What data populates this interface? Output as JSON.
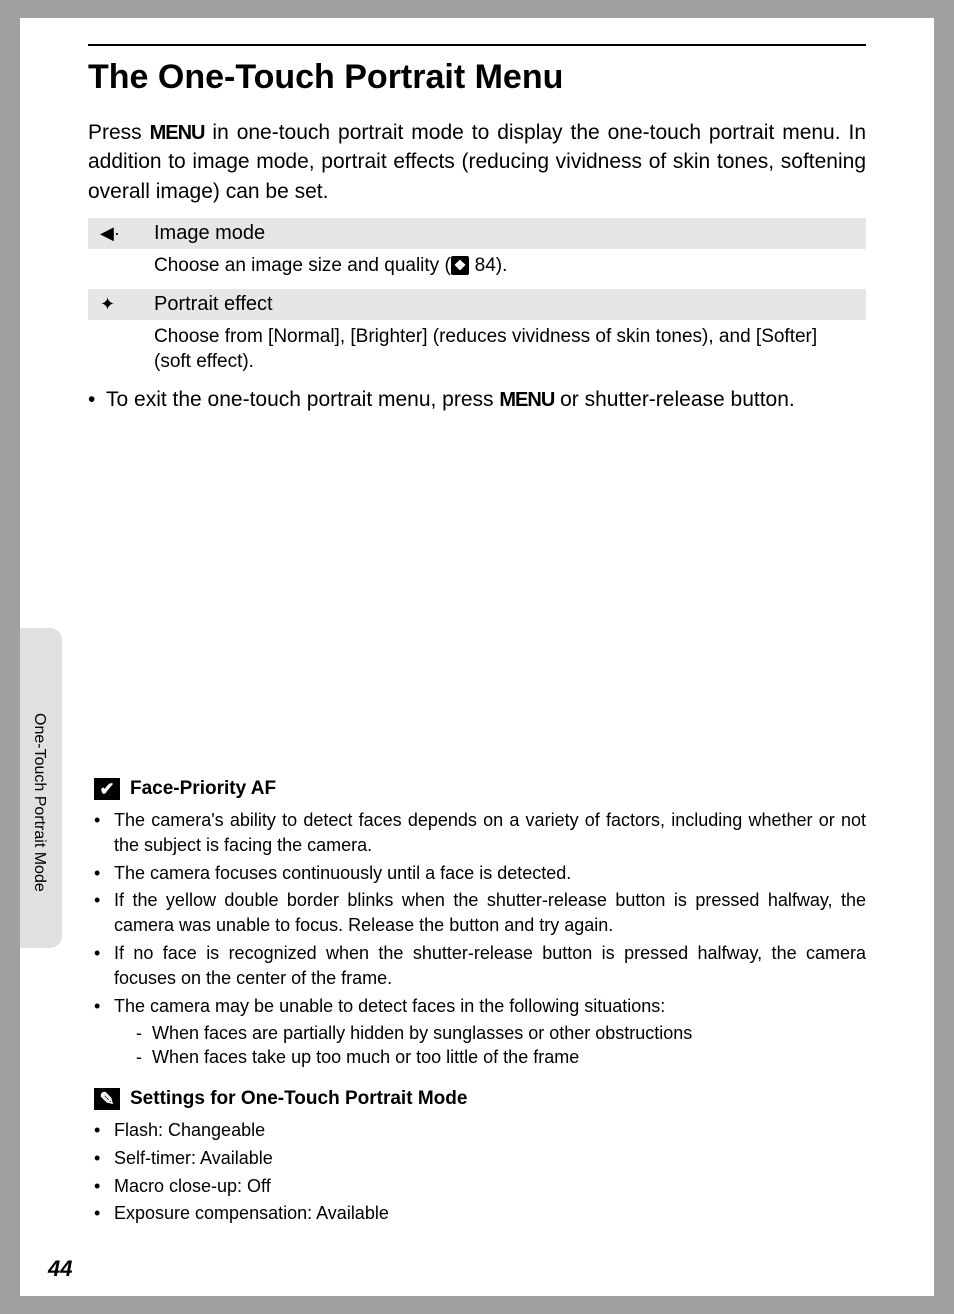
{
  "title": "The One-Touch Portrait Menu",
  "intro_pre": "Press ",
  "menu_glyph": "MENU",
  "intro_post": " in one-touch portrait mode to display the one-touch portrait menu. In addition to image mode, portrait effects (reducing vividness of skin tones, softening overall image) can be set.",
  "options": [
    {
      "icon": "◀·",
      "label": "Image mode",
      "desc_pre": "Choose an image size and quality (",
      "xref_icon": "❖",
      "xref_page": " 84).",
      "desc_post": ""
    },
    {
      "icon": "✦",
      "label": "Portrait effect",
      "desc_pre": "Choose from [Normal], [Brighter] (reduces vividness of skin tones), and [Softer] (soft effect).",
      "xref_icon": "",
      "xref_page": "",
      "desc_post": ""
    }
  ],
  "exit_pre": "To exit the one-touch portrait menu, press ",
  "exit_post": " or shutter-release button.",
  "side_label": "One-Touch Portrait Mode",
  "note1": {
    "badge": "✔",
    "title": "Face-Priority AF",
    "items": [
      "The camera's ability to detect faces depends on a variety of factors, including whether or not the subject is facing the camera.",
      "The camera focuses continuously until a face is detected.",
      "If the yellow double border blinks when the shutter-release button is pressed halfway, the camera was unable to focus. Release the button and try again.",
      "If no face is recognized when the shutter-release button is pressed halfway, the camera focuses on the center of the frame.",
      "The camera may be unable to detect faces in the following situations:"
    ],
    "sub_items": [
      "When faces are partially hidden by sunglasses or other obstructions",
      "When faces take up too much or too little of the frame"
    ]
  },
  "note2": {
    "badge": "✎",
    "title": "Settings for One-Touch Portrait Mode",
    "items": [
      "Flash: Changeable",
      "Self-timer: Available",
      "Macro close-up: Off",
      "Exposure compensation: Available"
    ]
  },
  "page_number": "44"
}
